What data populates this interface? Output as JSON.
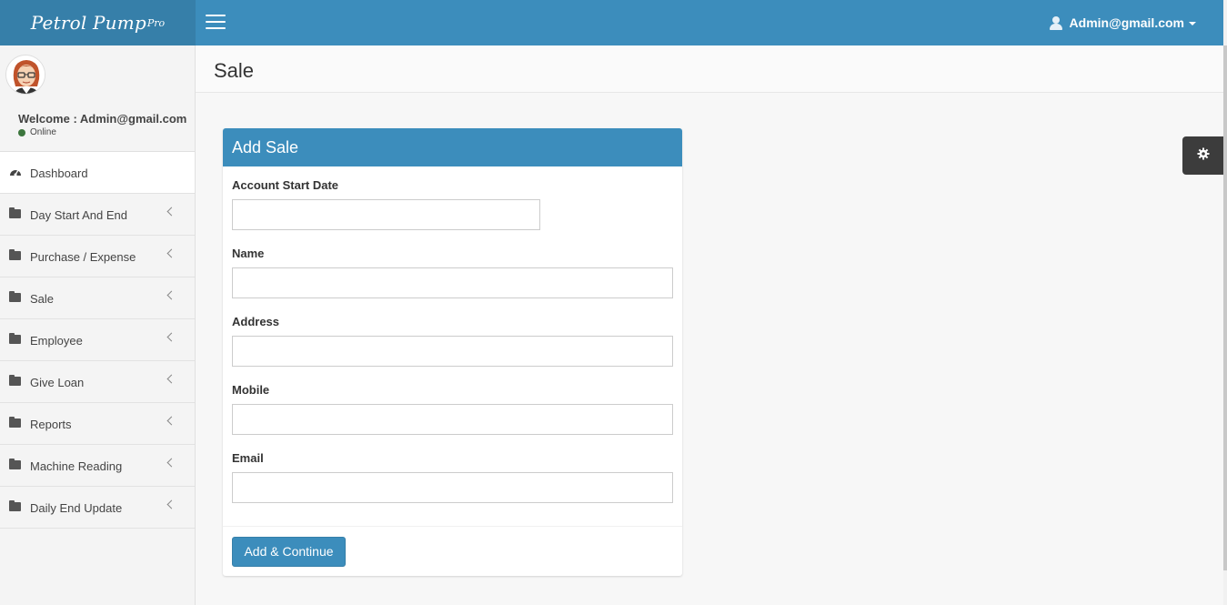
{
  "brand": {
    "name": "Petrol Pump",
    "suffix": "Pro"
  },
  "header": {
    "user_email": "Admin@gmail.com"
  },
  "sidebar": {
    "welcome": "Welcome : Admin@gmail.com",
    "status": "Online",
    "items": [
      {
        "label": "Dashboard",
        "icon": "dashboard-icon"
      },
      {
        "label": "Day Start And End",
        "icon": "folder-icon"
      },
      {
        "label": "Purchase / Expense",
        "icon": "folder-icon"
      },
      {
        "label": "Sale",
        "icon": "folder-icon"
      },
      {
        "label": "Employee",
        "icon": "folder-icon"
      },
      {
        "label": "Give Loan",
        "icon": "folder-icon"
      },
      {
        "label": "Reports",
        "icon": "folder-icon"
      },
      {
        "label": "Machine Reading",
        "icon": "folder-icon"
      },
      {
        "label": "Daily End Update",
        "icon": "folder-icon"
      }
    ]
  },
  "page": {
    "title": "Sale"
  },
  "form": {
    "title": "Add Sale",
    "fields": [
      {
        "label": "Account Start Date",
        "value": ""
      },
      {
        "label": "Name",
        "value": ""
      },
      {
        "label": "Address",
        "value": ""
      },
      {
        "label": "Mobile",
        "value": ""
      },
      {
        "label": "Email",
        "value": ""
      }
    ],
    "submit_label": "Add & Continue"
  },
  "colors": {
    "primary": "#3c8dbc",
    "primary_dark": "#367fa9",
    "online": "#3c763d"
  }
}
